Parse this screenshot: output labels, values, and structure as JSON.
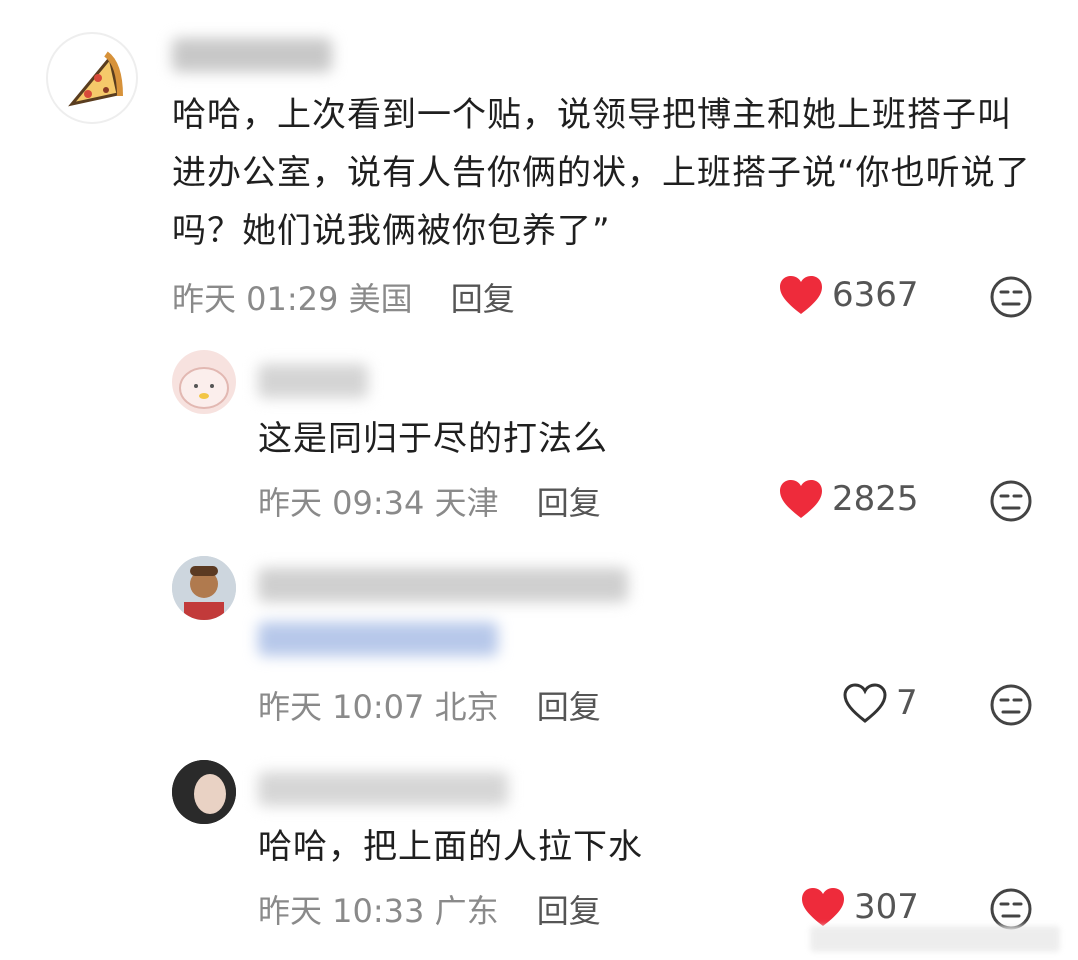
{
  "comments": [
    {
      "text": "哈哈，上次看到一个贴，说领导把博主和她上班搭子叫进办公室，说有人告你俩的状，上班搭子说“你也听说了吗？她们说我俩被你包养了”",
      "time": "昨天 01:29 美国",
      "reply_label": "回复",
      "likes": "6367",
      "liked": true
    },
    {
      "text": "这是同归于尽的打法么",
      "time": "昨天 09:34 天津",
      "reply_label": "回复",
      "likes": "2825",
      "liked": true
    },
    {
      "text": "",
      "time": "昨天 10:07 北京",
      "reply_label": "回复",
      "likes": "7",
      "liked": false
    },
    {
      "text": "哈哈，把上面的人拉下水",
      "time": "昨天 10:33 广东",
      "reply_label": "回复",
      "likes": "307",
      "liked": true
    }
  ],
  "colors": {
    "like_red": "#ee2b3b",
    "meta_gray": "#8a8a8a"
  },
  "icons": {
    "like": "heart-icon",
    "dislike": "meh-face-icon"
  }
}
